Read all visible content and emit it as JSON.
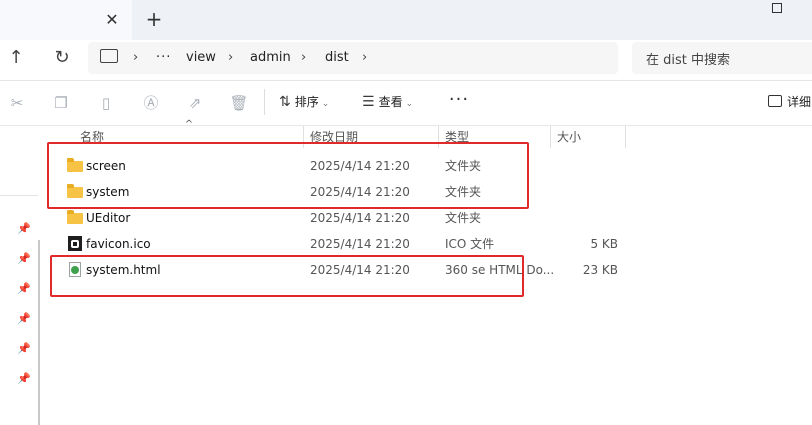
{
  "window": {
    "tab_close_icon": "close-icon",
    "new_tab_icon": "plus-icon"
  },
  "nav": {
    "up_icon": "arrow-up-icon",
    "refresh_icon": "refresh-icon",
    "pc_icon": "monitor-icon",
    "more_crumbs": "···",
    "breadcrumb": [
      "view",
      "admin",
      "dist"
    ],
    "search_placeholder": "在 dist 中搜索"
  },
  "toolbar": {
    "cut_icon": "scissors-icon",
    "copy_icon": "copy-icon",
    "paste_icon": "paste-icon",
    "rename_icon": "rename-icon",
    "share_icon": "share-icon",
    "delete_icon": "trash-icon",
    "sort_label": "排序",
    "view_label": "查看",
    "more_label": "···",
    "details_label": "详细"
  },
  "columns": {
    "name": "名称",
    "date": "修改日期",
    "type": "类型",
    "size": "大小"
  },
  "files": [
    {
      "name": "screen",
      "date": "2025/4/14 21:20",
      "type": "文件夹",
      "size": "",
      "icon": "folder-icon"
    },
    {
      "name": "system",
      "date": "2025/4/14 21:20",
      "type": "文件夹",
      "size": "",
      "icon": "folder-icon"
    },
    {
      "name": "UEditor",
      "date": "2025/4/14 21:20",
      "type": "文件夹",
      "size": "",
      "icon": "folder-icon"
    },
    {
      "name": "favicon.ico",
      "date": "2025/4/14 21:20",
      "type": "ICO 文件",
      "size": "5 KB",
      "icon": "ico-file-icon"
    },
    {
      "name": "system.html",
      "date": "2025/4/14 21:20",
      "type": "360 se HTML Do...",
      "size": "23 KB",
      "icon": "html-file-icon"
    }
  ],
  "colors": {
    "annotation": "#e02a2a",
    "folder": "#f6c344"
  }
}
